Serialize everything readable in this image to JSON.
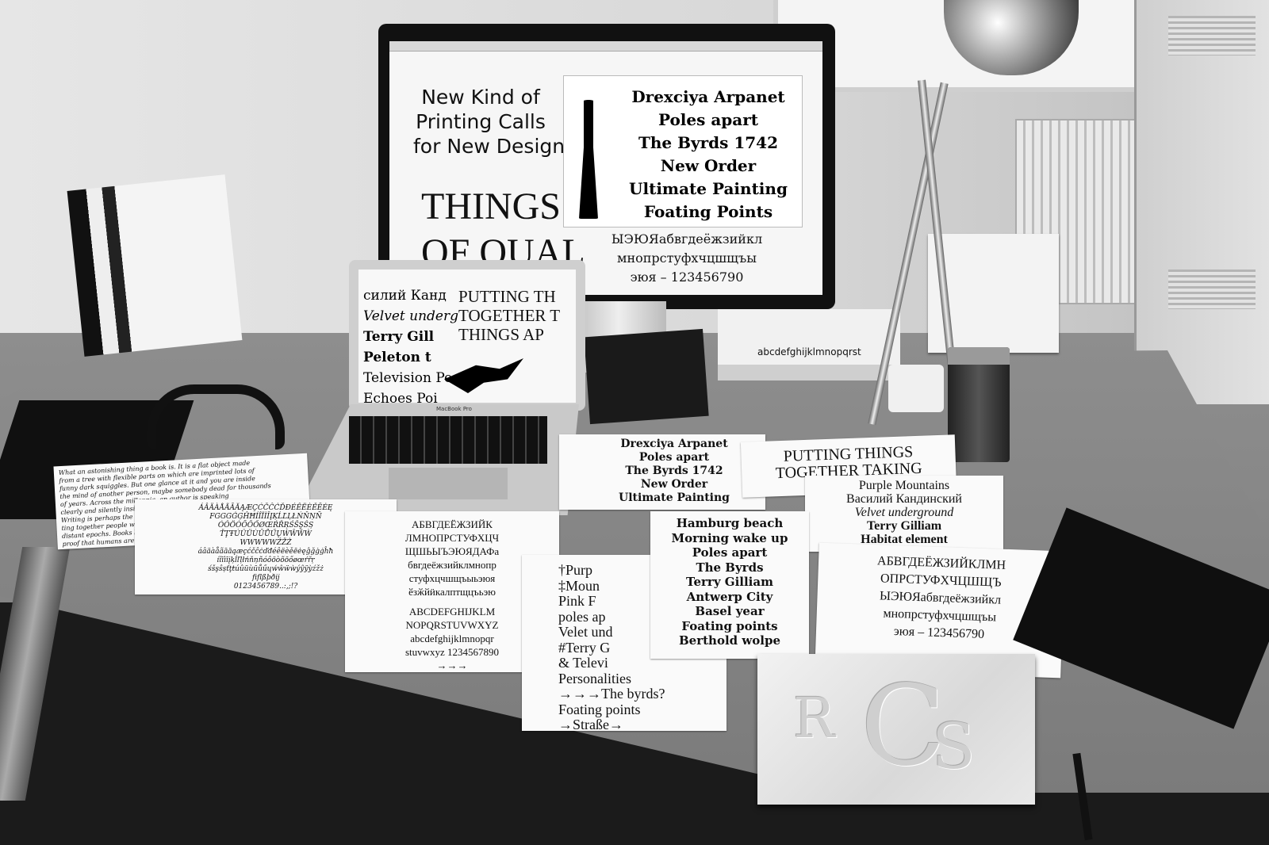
{
  "monitor": {
    "heading_lines": [
      "New Kind of",
      "Printing Calls",
      "for New Design"
    ],
    "big_lines": [
      "THINGS",
      "OF QUAL"
    ],
    "bold_lines": [
      "Drexciya Arpanet",
      "Poles apart",
      "The Byrds 1742",
      "New Order",
      "Ultimate Painting",
      "Foating Points"
    ],
    "cyrillic_lines": [
      "ЫЭЮЯабвгдеёжзийкл",
      "мнопрстуфхчцшщъы",
      "эюя – 123456790"
    ]
  },
  "laptop": {
    "left_lines": [
      "силий Канд",
      "Velvet underg",
      "Terry Gill",
      "Peleton t",
      "Television Pe",
      "Echoes Poi"
    ],
    "right_lines": [
      "PUTTING TH",
      "TOGETHER T",
      "THINGS AP"
    ]
  },
  "sheets": {
    "specimen_center": [
      "Drexciya Arpanet",
      "Poles apart",
      "The Byrds 1742",
      "New Order",
      "Ultimate Painting"
    ],
    "putting": [
      "PUTTING THINGS",
      "TOGETHER TAKING"
    ],
    "purple": [
      "Purple Mountains",
      "Василий Кандинский",
      "Velvet underground",
      "Terry Gilliam",
      "Habitat element"
    ],
    "cyrillic_sheet": [
      "АБВГДЕЁЖЗИЙКЛМН",
      "ОПРСТУФХЧЦШЩЪ",
      "ЫЭЮЯабвгдеёжзийкл",
      "мнопрстуфхчцшщъы",
      "эюя – 123456790"
    ],
    "hamburg": [
      "Hamburg beach",
      "Morning wake up",
      "Poles apart",
      "The Byrds",
      "Terry Gilliam",
      "Antwerp City",
      "Basel year",
      "Foating points",
      "Berthold wolpe"
    ],
    "purple_list": [
      "†Purp",
      "‡Moun",
      "Pink F",
      "poles ap",
      "Velet und",
      "#Terry G",
      "& Televi",
      "Personalities",
      "→→→The byrds?",
      "Foating points",
      "→Straße→"
    ],
    "alphabet": [
      "АБВГДЕЁЖЗИЙК",
      "ЛМНОПРСТУФХЦЧ",
      "ЩШЬЫЪЭЮЯДАФа",
      "бвгдеёжзийклмнопр",
      "стуфхцчшщъыьэюя",
      "ӗзӂйӥкалптщцъьэю",
      "ABCDEFGHIJKLM",
      "NOPQRSTUVWXYZ",
      "abcdefghijklmnopqr",
      "stuvwxyz 1234567890",
      "→→→"
    ],
    "accents": [
      "ÁÂÄÀÅÃĀĂĄÆÇĆČĈĊĎĐÉÊËÈĚĒĖĘ",
      "FGGGĠĢĤĦÍÎÏÌĪĮĶĹĽĻŁŃŇŅÑ",
      "ÓÔÖÒÕŌŐØŒŔŘŖŚŠŞŜȘ",
      "ŤŢŦÚÛÜÙŪŮŰŲẂŴẄẀ",
      "WWWWWŹŽŻ"
    ],
    "accents_lower": [
      "áâäàåãāăąæçćčĉċďđéêëèěēėęĝğġģĥħ",
      "íîïìīįķĺľļłńňņñóôöòõōőøœŕřŗ",
      "śšşŝșťţŧúûüùūůűųẃŵẅẁýŷÿỳźžż",
      "ﬁﬂßþðĳ",
      "0123456789..:,;!?"
    ],
    "essay": [
      "What an astonishing thing a book is. It is a flat object made",
      "from a tree with flexible parts on which are imprinted lots of",
      "funny dark squiggles. But one glance at it and you are inside",
      "the mind of another person, maybe somebody dead for thousands",
      "of years. Across the millennia, an author is speaking",
      "clearly and silently inside your head",
      "Writing is perhaps the greatest of",
      "ting together people who never kne",
      "distant epochs. Books break the sh",
      "proof that humans are capable of"
    ]
  },
  "book_spine": "abcdefghijklmnopqrst",
  "laptop_label": "MacBook Pro",
  "marble_letters": [
    "R",
    "C",
    "S"
  ],
  "colors": {
    "paper": "#fafafa",
    "ink": "#111111",
    "desk": "#808080"
  }
}
